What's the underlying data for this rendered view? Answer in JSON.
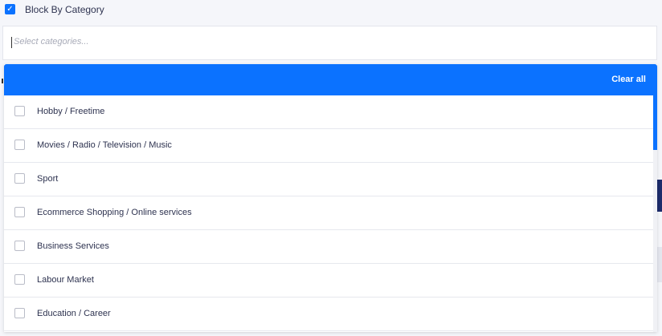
{
  "filter": {
    "checkbox_checked": true,
    "checkmark": "✓",
    "label": "Block By Category"
  },
  "select": {
    "placeholder": "Select categories..."
  },
  "dropdown": {
    "clear_all_label": "Clear all",
    "accent_color": "#0b72ff",
    "items": [
      {
        "label": "Hobby / Freetime",
        "checked": false
      },
      {
        "label": "Movies / Radio / Television / Music",
        "checked": false
      },
      {
        "label": "Sport",
        "checked": false
      },
      {
        "label": "Ecommerce Shopping / Online services",
        "checked": false
      },
      {
        "label": "Business Services",
        "checked": false
      },
      {
        "label": "Labour Market",
        "checked": false
      },
      {
        "label": "Education / Career",
        "checked": false
      }
    ]
  }
}
